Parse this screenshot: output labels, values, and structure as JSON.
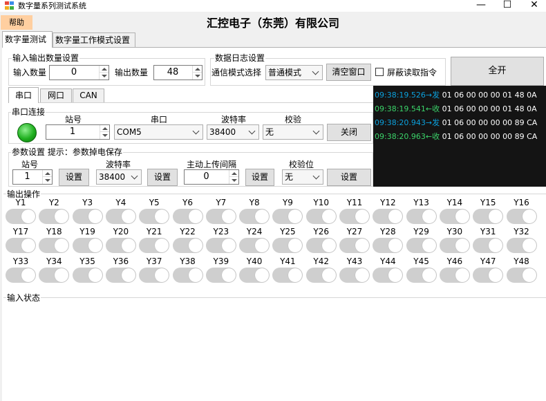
{
  "window": {
    "title": "数字量系列测试系统",
    "minimize": "—",
    "maximize": "☐",
    "close": "✕"
  },
  "menu": {
    "help": "帮助"
  },
  "header": {
    "company": "汇控电子（东莞）有限公司"
  },
  "tabs": [
    {
      "label": "数字量测试"
    },
    {
      "label": "数字量工作模式设置"
    }
  ],
  "io_count": {
    "title": "输入输出数量设置",
    "input_label": "输入数量",
    "input_value": "0",
    "output_label": "输出数量",
    "output_value": "48"
  },
  "log_settings": {
    "title": "数据日志设置",
    "mode_label": "通信模式选择",
    "mode_value": "普通模式",
    "clear_label": "清空窗口",
    "mask_label": "屏蔽读取指令",
    "mask_checked": false
  },
  "open_all": "全开",
  "comm_tabs": [
    {
      "label": "串口"
    },
    {
      "label": "网口"
    },
    {
      "label": "CAN"
    }
  ],
  "serial": {
    "title": "串口连接",
    "station_label": "站号",
    "station_value": "1",
    "port_label": "串口",
    "port_value": "COM5",
    "baud_label": "波特率",
    "baud_value": "38400",
    "parity_label": "校验",
    "parity_value": "无",
    "close_label": "关闭",
    "led_color": "#20b020"
  },
  "params": {
    "title": "参数设置 提示：参数掉电保存",
    "station_label": "站号",
    "station_value": "1",
    "set1": "设置",
    "baud_label": "波特率",
    "baud_value": "38400",
    "set2": "设置",
    "interval_label": "主动上传间隔",
    "interval_value": "0",
    "set3": "设置",
    "parity_label": "校验位",
    "parity_value": "无",
    "set4": "设置"
  },
  "log": [
    {
      "time": "09:38:19.526→发",
      "data": " 01 06 00 00 00 01 48 0A",
      "dir": "tx"
    },
    {
      "time": "09:38:19.541←收",
      "data": " 01 06 00 00 00 01 48 0A",
      "dir": "rx"
    },
    {
      "time": "09:38:20.943→发",
      "data": " 01 06 00 00 00 00 89 CA",
      "dir": "tx"
    },
    {
      "time": "09:38:20.963←收",
      "data": " 01 06 00 00 00 00 89 CA",
      "dir": "rx"
    }
  ],
  "output_ops": {
    "title": "输出操作",
    "outputs": [
      "Y1",
      "Y2",
      "Y3",
      "Y4",
      "Y5",
      "Y6",
      "Y7",
      "Y8",
      "Y9",
      "Y10",
      "Y11",
      "Y12",
      "Y13",
      "Y14",
      "Y15",
      "Y16",
      "Y17",
      "Y18",
      "Y19",
      "Y20",
      "Y21",
      "Y22",
      "Y23",
      "Y24",
      "Y25",
      "Y26",
      "Y27",
      "Y28",
      "Y29",
      "Y30",
      "Y31",
      "Y32",
      "Y33",
      "Y34",
      "Y35",
      "Y36",
      "Y37",
      "Y38",
      "Y39",
      "Y40",
      "Y41",
      "Y42",
      "Y43",
      "Y44",
      "Y45",
      "Y46",
      "Y47",
      "Y48"
    ]
  },
  "input_status": {
    "title": "输入状态"
  }
}
